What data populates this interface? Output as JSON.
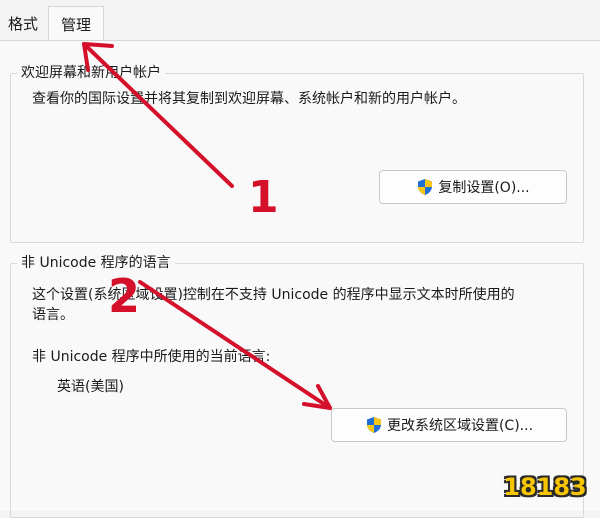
{
  "tabs": [
    {
      "label": "格式"
    },
    {
      "label": "管理"
    }
  ],
  "welcome_group": {
    "title": "欢迎屏幕和新用户帐户",
    "description": "查看你的国际设置并将其复制到欢迎屏幕、系统帐户和新的用户帐户。",
    "copy_button": "复制设置(O)..."
  },
  "unicode_group": {
    "title": "非 Unicode 程序的语言",
    "description_line1": "这个设置(系统区域设置)控制在不支持 Unicode 的程序中显示文本时所使用的",
    "description_line2": "语言。",
    "current_label": "非 Unicode 程序中所使用的当前语言:",
    "current_value": "英语(美国)",
    "change_button": "更改系统区域设置(C)..."
  },
  "annotations": {
    "mark_one": "1",
    "mark_two": "2"
  },
  "watermark": {
    "text": "18183"
  },
  "colors": {
    "annotation_red": "#d4102a",
    "shield_blue": "#1f6fd6",
    "shield_yellow": "#f5c518"
  }
}
